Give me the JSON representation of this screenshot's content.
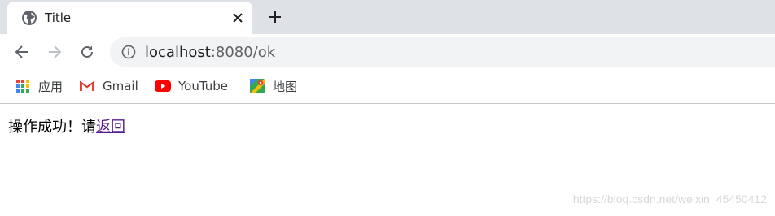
{
  "tab": {
    "title": "Title",
    "favicon": "globe-icon"
  },
  "omnibox": {
    "host": "localhost",
    "rest": ":8080/ok"
  },
  "bookmarks": [
    {
      "label": "应用",
      "icon": "apps-grid-icon"
    },
    {
      "label": "Gmail",
      "icon": "gmail-icon"
    },
    {
      "label": "YouTube",
      "icon": "youtube-icon"
    },
    {
      "label": "地图",
      "icon": "maps-icon"
    }
  ],
  "page": {
    "message": "操作成功！请",
    "link_text": "返回"
  },
  "watermark": "https://blog.csdn.net/weixin_45450412",
  "colors": {
    "tabstrip": "#dee1e6",
    "omnibox": "#f1f3f4",
    "link_visited": "#551a8b"
  }
}
